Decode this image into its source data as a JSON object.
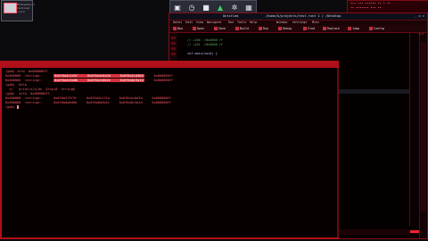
{
  "mini_window": {
    "lines": "Workspace 1\nterminal\n~/src"
  },
  "dock": {
    "items": [
      {
        "icon": "terminal-icon",
        "glyph": "▣"
      },
      {
        "icon": "clock-icon",
        "glyph": "◷"
      },
      {
        "icon": "stop-icon",
        "glyph": "■"
      },
      {
        "icon": "monitor-icon",
        "glyph": "▲"
      },
      {
        "icon": "settings-icon",
        "glyph": "✲"
      },
      {
        "icon": "apps-icon",
        "glyph": "▦"
      }
    ]
  },
  "tray": {
    "line1": "••• ••• •••••• •• • ••",
    "line2": "•• ••••••• ••• ••"
  },
  "editor": {
    "title": "/home/k/projects/test.rust  1  /  /Desktop",
    "app": "Untitled",
    "controls": "_  ◻  ×",
    "menu": [
      "Datei",
      "Edit",
      "View",
      "Navigate",
      "Run",
      "Tools",
      "Help",
      "Window",
      "Settings",
      "Misc"
    ],
    "toolbar": [
      "New",
      "Open",
      "Save",
      "Build",
      "Run",
      "Debug",
      "Find",
      "Replace",
      "Jump",
      "Config"
    ],
    "code": [
      {
        "text": "// +100 ->0x0000 ff",
        "color": "#5aa85a"
      },
      {
        "text": "// +101 ->0x0000 ff",
        "color": "#5aa85a"
      },
      {
        "text": "",
        "color": "#c0c0c0"
      },
      {
        "text": "int  main(void)  {",
        "color": "#c8c0ff"
      }
    ],
    "gutter_mark": "1:1",
    "accent": "#b0101a"
  },
  "terminal": {
    "lines": [
      {
        "pre": "(gdb) info  0x000000ff",
        "hl": ""
      },
      {
        "pre": "0x000060  <string>:      ",
        "hl": "0x0f0a4c2d3f     0x0f0a4c0a3d     0x0f0a2cd4b6",
        "post": "     0x000000ff"
      },
      {
        "pre": "0x000060  <string>:      ",
        "hl": "0x0f0a4c0a0b     0x0f0a1c6b2e     0x0f0a0c3a1d",
        "post": "     0x000000ff"
      },
      {
        "pre": "(gdb)  help",
        "hl": ""
      },
      {
        "pre": "  x/   print/x/s/an  $rsp+8  string@",
        "hl": ""
      },
      {
        "pre": "(gdb)  info  0x000000ff",
        "hl": ""
      },
      {
        "pre": "0x000060  <string>:      0x0f0a2f3f3f     0x0f0a3c2f1d     0x0f0a4c0a3d     0x000000ff",
        "hl": ""
      },
      {
        "pre": "0x000060  <string>:      0x0f0a0a0d0d     0x0f0a0d2b4c     0x0f0a0c3a1d     0x000000ff",
        "hl": ""
      },
      {
        "pre": "(gdb) ",
        "hl": "",
        "cursor": true
      }
    ]
  }
}
